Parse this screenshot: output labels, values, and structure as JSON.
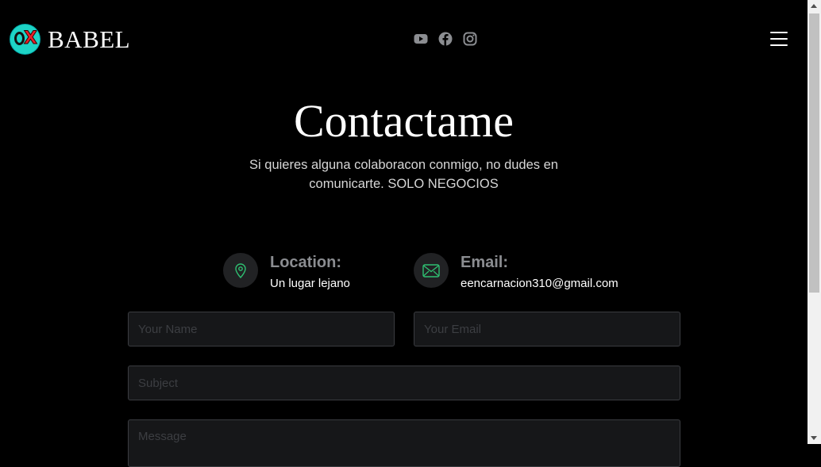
{
  "header": {
    "brand": "BABEL",
    "logo_glyph_o": "0",
    "logo_glyph_x": "X",
    "social_icons": [
      "youtube-icon",
      "facebook-icon",
      "instagram-icon"
    ],
    "menu_icon": "hamburger-menu-icon"
  },
  "hero": {
    "title": "Contactame",
    "subtitle": "Si quieres alguna colaboracon conmigo, no dudes en comunicarte. SOLO NEGOCIOS"
  },
  "contact_info": [
    {
      "icon": "map-pin-icon",
      "label": "Location:",
      "value": "Un lugar lejano"
    },
    {
      "icon": "envelope-icon",
      "label": "Email:",
      "value": "eencarnacion310@gmail.com"
    }
  ],
  "form": {
    "name_placeholder": "Your Name",
    "email_placeholder": "Your Email",
    "subject_placeholder": "Subject",
    "message_placeholder": "Message"
  },
  "colors": {
    "background": "#000000",
    "accent_green": "#2fbf71",
    "field_bg": "#161719",
    "icon_grey": "#8b8d91",
    "logo_cyan": "#1ed4c6",
    "logo_red": "#e8202a"
  }
}
